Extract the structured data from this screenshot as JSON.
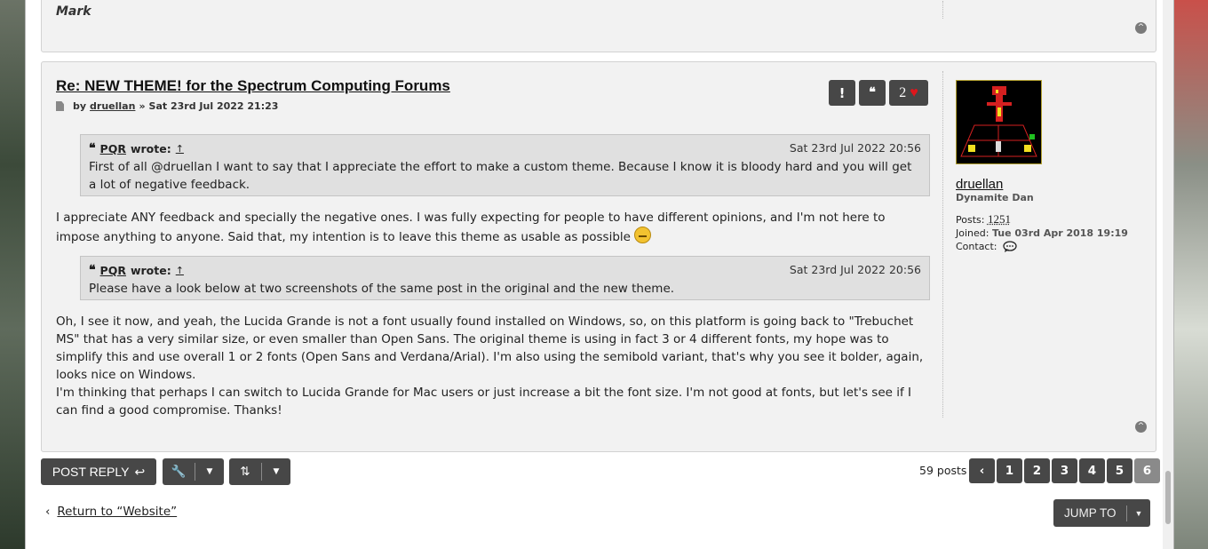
{
  "prev_post": {
    "signature": "Mark",
    "top_icon": "^"
  },
  "post": {
    "title": "Re: NEW THEME! for the Spectrum Computing Forums",
    "by_label": "by",
    "author": "druellan",
    "date_sep": "»",
    "date": "Sat 23rd Jul 2022 21:23",
    "actions": {
      "report_icon": "!",
      "quote_icon": "❝",
      "like_count": "2",
      "heart_icon": "♥"
    },
    "quotes": [
      {
        "author": "PQR",
        "wrote_label": "wrote:",
        "arrow": "↑",
        "date": "Sat 23rd Jul 2022 20:56",
        "text": "First of all @druellan I want to say that I appreciate the effort to make a custom theme. Because I know it is bloody hard and you will get a lot of negative feedback."
      },
      {
        "author": "PQR",
        "wrote_label": "wrote:",
        "arrow": "↑",
        "date": "Sat 23rd Jul 2022 20:56",
        "text": "Please have a look below at two screenshots of the same post in the original and the new theme."
      }
    ],
    "paragraph1": "I appreciate ANY feedback and specially the negative ones. I was fully expecting for people to have different opinions, and I'm not here to impose anything to anyone. Said that, my intention is to leave this theme as usable as possible",
    "paragraph2a": "Oh, I see it now, and yeah, the Lucida Grande is not a font usually found installed on Windows, so, on this platform is going back to \"Trebuchet MS\" that has a very similar size, or even smaller than Open Sans. The original theme is using in fact 3 or 4 different fonts, my hope was to simplify this and use overall 1 or 2 fonts (Open Sans and Verdana/Arial). I'm also using the semibold variant, that's why you see it bolder, again, looks nice on Windows.",
    "paragraph2b": "I'm thinking that perhaps I can switch to Lucida Grande for Mac users or just increase a bit the font size. I'm not good at fonts, but let's see if I can find a good compromise. Thanks!",
    "profile": {
      "username": "druellan",
      "rank": "Dynamite Dan",
      "posts_label": "Posts:",
      "posts": "1251",
      "joined_label": "Joined:",
      "joined": "Tue 03rd Apr 2018 19:19",
      "contact_label": "Contact:"
    }
  },
  "toolbar": {
    "post_reply": "POST REPLY",
    "reply_icon": "↩",
    "tools_icon": "🔧",
    "sort_icon": "⇅",
    "caret": "▼"
  },
  "pagination": {
    "count": "59 posts",
    "prev_icon": "‹",
    "pages": [
      "1",
      "2",
      "3",
      "4",
      "5",
      "6"
    ],
    "current": "6"
  },
  "footer": {
    "return_arrow": "‹",
    "return_label": "Return to “Website”",
    "jump_label": "JUMP TO"
  },
  "colors": {
    "button_bg": "#474747",
    "current_page": "#8a8a8a",
    "heart": "#e0161c"
  }
}
